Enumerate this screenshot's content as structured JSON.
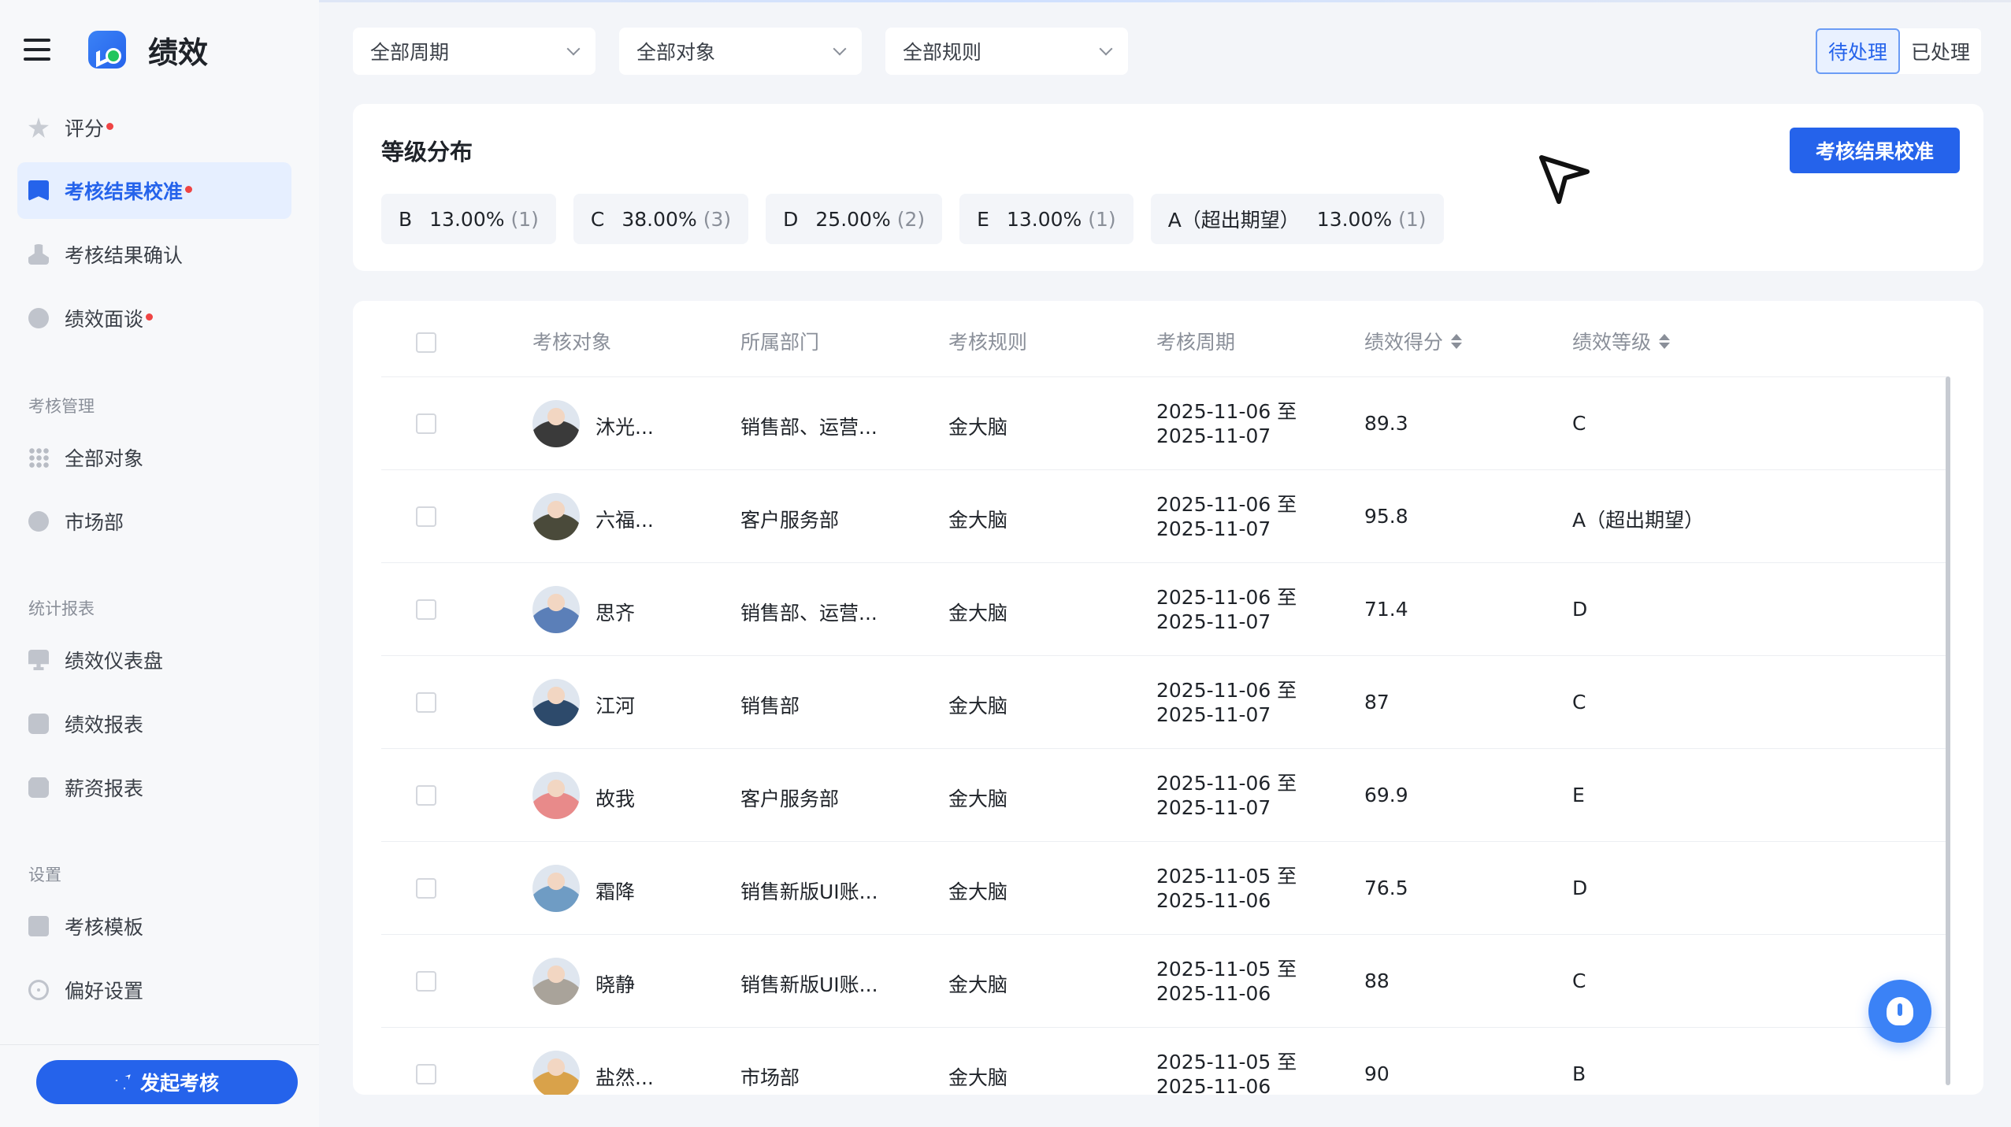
{
  "app": {
    "title": "绩效"
  },
  "nav": {
    "top_items": [
      {
        "label": "评分",
        "dot": true,
        "icon": "star-icon"
      },
      {
        "label": "考核结果校准",
        "dot": true,
        "active": true,
        "icon": "bookmark-icon"
      },
      {
        "label": "考核结果确认",
        "dot": false,
        "icon": "user-confirm-icon"
      },
      {
        "label": "绩效面谈",
        "dot": true,
        "icon": "chat-icon"
      }
    ],
    "sections": [
      {
        "label": "考核管理",
        "items": [
          {
            "label": "全部对象",
            "icon": "grid-icon"
          },
          {
            "label": "市场部",
            "icon": "department-icon"
          }
        ]
      },
      {
        "label": "统计报表",
        "items": [
          {
            "label": "绩效仪表盘",
            "icon": "dashboard-icon"
          },
          {
            "label": "绩效报表",
            "icon": "report-icon"
          },
          {
            "label": "薪资报表",
            "icon": "wallet-icon"
          }
        ]
      },
      {
        "label": "设置",
        "items": [
          {
            "label": "考核模板",
            "icon": "template-icon"
          },
          {
            "label": "偏好设置",
            "icon": "gear-icon"
          }
        ]
      }
    ],
    "launch_button": "发起考核"
  },
  "filters": {
    "period": "全部周期",
    "target": "全部对象",
    "rule": "全部规则"
  },
  "status_toggle": {
    "pending": "待处理",
    "done": "已处理",
    "selected": "pending"
  },
  "grade_card": {
    "title": "等级分布",
    "calibrate_button": "考核结果校准",
    "chips": [
      {
        "grade": "B",
        "percent": "13.00%",
        "count": "(1)"
      },
      {
        "grade": "C",
        "percent": "38.00%",
        "count": "(3)"
      },
      {
        "grade": "D",
        "percent": "25.00%",
        "count": "(2)"
      },
      {
        "grade": "E",
        "percent": "13.00%",
        "count": "(1)"
      },
      {
        "grade": "A（超出期望）",
        "percent": "13.00%",
        "count": "(1)"
      }
    ]
  },
  "table": {
    "headers": {
      "target": "考核对象",
      "dept": "所属部门",
      "rule": "考核规则",
      "period": "考核周期",
      "score": "绩效得分",
      "grade": "绩效等级"
    },
    "rows": [
      {
        "name": "沐光...",
        "dept": "销售部、运营...",
        "rule": "金大脑",
        "period_start": "2025-11-06 至",
        "period_end": "2025-11-07",
        "score": "89.3",
        "grade": "C",
        "avatar_color": "#3a3a3a"
      },
      {
        "name": "六福...",
        "dept": "客户服务部",
        "rule": "金大脑",
        "period_start": "2025-11-06 至",
        "period_end": "2025-11-07",
        "score": "95.8",
        "grade": "A（超出期望）",
        "avatar_color": "#4a4a3a"
      },
      {
        "name": "思齐",
        "dept": "销售部、运营...",
        "rule": "金大脑",
        "period_start": "2025-11-06 至",
        "period_end": "2025-11-07",
        "score": "71.4",
        "grade": "D",
        "avatar_color": "#5b7fb8"
      },
      {
        "name": "江河",
        "dept": "销售部",
        "rule": "金大脑",
        "period_start": "2025-11-06 至",
        "period_end": "2025-11-07",
        "score": "87",
        "grade": "C",
        "avatar_color": "#2d4a6b"
      },
      {
        "name": "故我",
        "dept": "客户服务部",
        "rule": "金大脑",
        "period_start": "2025-11-06 至",
        "period_end": "2025-11-07",
        "score": "69.9",
        "grade": "E",
        "avatar_color": "#e88a8a"
      },
      {
        "name": "霜降",
        "dept": "销售新版UI账...",
        "rule": "金大脑",
        "period_start": "2025-11-05 至",
        "period_end": "2025-11-06",
        "score": "76.5",
        "grade": "D",
        "avatar_color": "#6f9cc4"
      },
      {
        "name": "晓静",
        "dept": "销售新版UI账...",
        "rule": "金大脑",
        "period_start": "2025-11-05 至",
        "period_end": "2025-11-06",
        "score": "88",
        "grade": "C",
        "avatar_color": "#a9a39a"
      },
      {
        "name": "盐然...",
        "dept": "市场部",
        "rule": "金大脑",
        "period_start": "2025-11-05 至",
        "period_end": "2025-11-06",
        "score": "90",
        "grade": "B",
        "avatar_color": "#d9a24a"
      }
    ]
  }
}
